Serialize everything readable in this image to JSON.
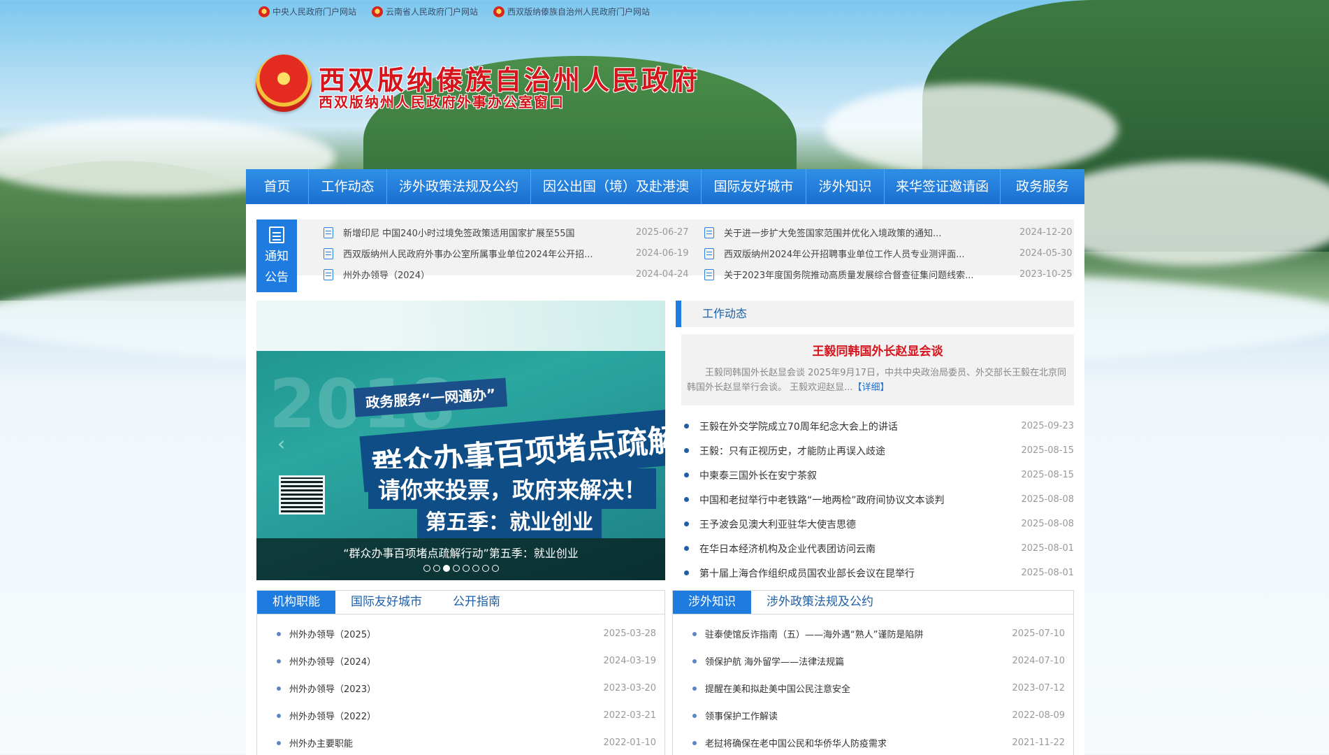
{
  "top_links": [
    {
      "label": "中央人民政府门户网站"
    },
    {
      "label": "云南省人民政府门户网站"
    },
    {
      "label": "西双版纳傣族自治州人民政府门户网站"
    }
  ],
  "header": {
    "title": "西双版纳傣族自治州人民政府",
    "subtitle": "西双版纳州人民政府外事办公室窗口"
  },
  "nav": [
    "首页",
    "工作动态",
    "涉外政策法规及公约",
    "因公出国（境）及赴港澳",
    "国际友好城市",
    "涉外知识",
    "来华签证邀请函",
    "政务服务"
  ],
  "notice": {
    "label_line1": "通知",
    "label_line2": "公告",
    "items": [
      {
        "title": "新增印尼 中国240小时过境免签政策适用国家扩展至55国",
        "date": "2025-06-27"
      },
      {
        "title": "关于进一步扩大免签国家范围并优化入境政策的通知...",
        "date": "2024-12-20"
      },
      {
        "title": "西双版纳州人民政府外事办公室所属事业单位2024年公开招...",
        "date": "2024-06-19"
      },
      {
        "title": "西双版纳州2024年公开招聘事业单位工作人员专业测评面...",
        "date": "2024-05-30"
      },
      {
        "title": "州外办领导（2024）",
        "date": "2024-04-24"
      },
      {
        "title": "关于2023年度国务院推动高质量发展综合督查征集问题线索...",
        "date": "2023-10-25"
      }
    ]
  },
  "slider": {
    "year_watermark": "2018",
    "banner": "政务服务“一网通办”",
    "headline": "群众办事百项堵点疏解行动",
    "subline": "请你来投票，政府来解决！",
    "season": "第五季：就业创业",
    "caption": "“群众办事百项堵点疏解行动”第五季：就业创业",
    "dots": 8,
    "active_dot": 3
  },
  "work": {
    "heading": "工作动态",
    "feature": {
      "title": "王毅同韩国外长赵显会谈",
      "body": "王毅同韩国外长赵显会谈 2025年9月17日，中共中央政治局委员、外交部长王毅在北京同韩国外长赵显举行会谈。 王毅欢迎赵显...",
      "more": "【详细】"
    },
    "items": [
      {
        "title": "王毅在外交学院成立70周年纪念大会上的讲话",
        "date": "2025-09-23"
      },
      {
        "title": "王毅：只有正视历史，才能防止再误入歧途",
        "date": "2025-08-15"
      },
      {
        "title": "中柬泰三国外长在安宁茶叙",
        "date": "2025-08-15"
      },
      {
        "title": "中国和老挝举行中老铁路“一地两检”政府间协议文本谈判",
        "date": "2025-08-08"
      },
      {
        "title": "王予波会见澳大利亚驻华大使吉思德",
        "date": "2025-08-08"
      },
      {
        "title": "在华日本经济机构及企业代表团访问云南",
        "date": "2025-08-01"
      },
      {
        "title": "第十届上海合作组织成员国农业部长会议在昆举行",
        "date": "2025-08-01"
      }
    ]
  },
  "left_box": {
    "tabs": [
      "机构职能",
      "国际友好城市",
      "公开指南"
    ],
    "active_tab": 0,
    "items": [
      {
        "title": "州外办领导（2025）",
        "date": "2025-03-28"
      },
      {
        "title": "州外办领导（2024）",
        "date": "2024-03-19"
      },
      {
        "title": "州外办领导（2023）",
        "date": "2023-03-20"
      },
      {
        "title": "州外办领导（2022）",
        "date": "2022-03-21"
      },
      {
        "title": "州外办主要职能",
        "date": "2022-01-10"
      }
    ]
  },
  "right_box": {
    "tabs": [
      "涉外知识",
      "涉外政策法规及公约"
    ],
    "active_tab": 0,
    "items": [
      {
        "title": "驻泰使馆反诈指南（五）——海外遇“熟人”谨防是陷阱",
        "date": "2025-07-10"
      },
      {
        "title": "领保护航 海外留学——法律法规篇",
        "date": "2024-07-10"
      },
      {
        "title": "提醒在美和拟赴美中国公民注意安全",
        "date": "2023-07-12"
      },
      {
        "title": "领事保护工作解读",
        "date": "2022-08-09"
      },
      {
        "title": "老挝将确保在老中国公民和华侨华人防疫需求",
        "date": "2021-11-22"
      }
    ]
  },
  "colors": {
    "nav_blue": "#1e7be0",
    "title_red": "#d5141c",
    "link_blue": "#1e5fa8"
  }
}
